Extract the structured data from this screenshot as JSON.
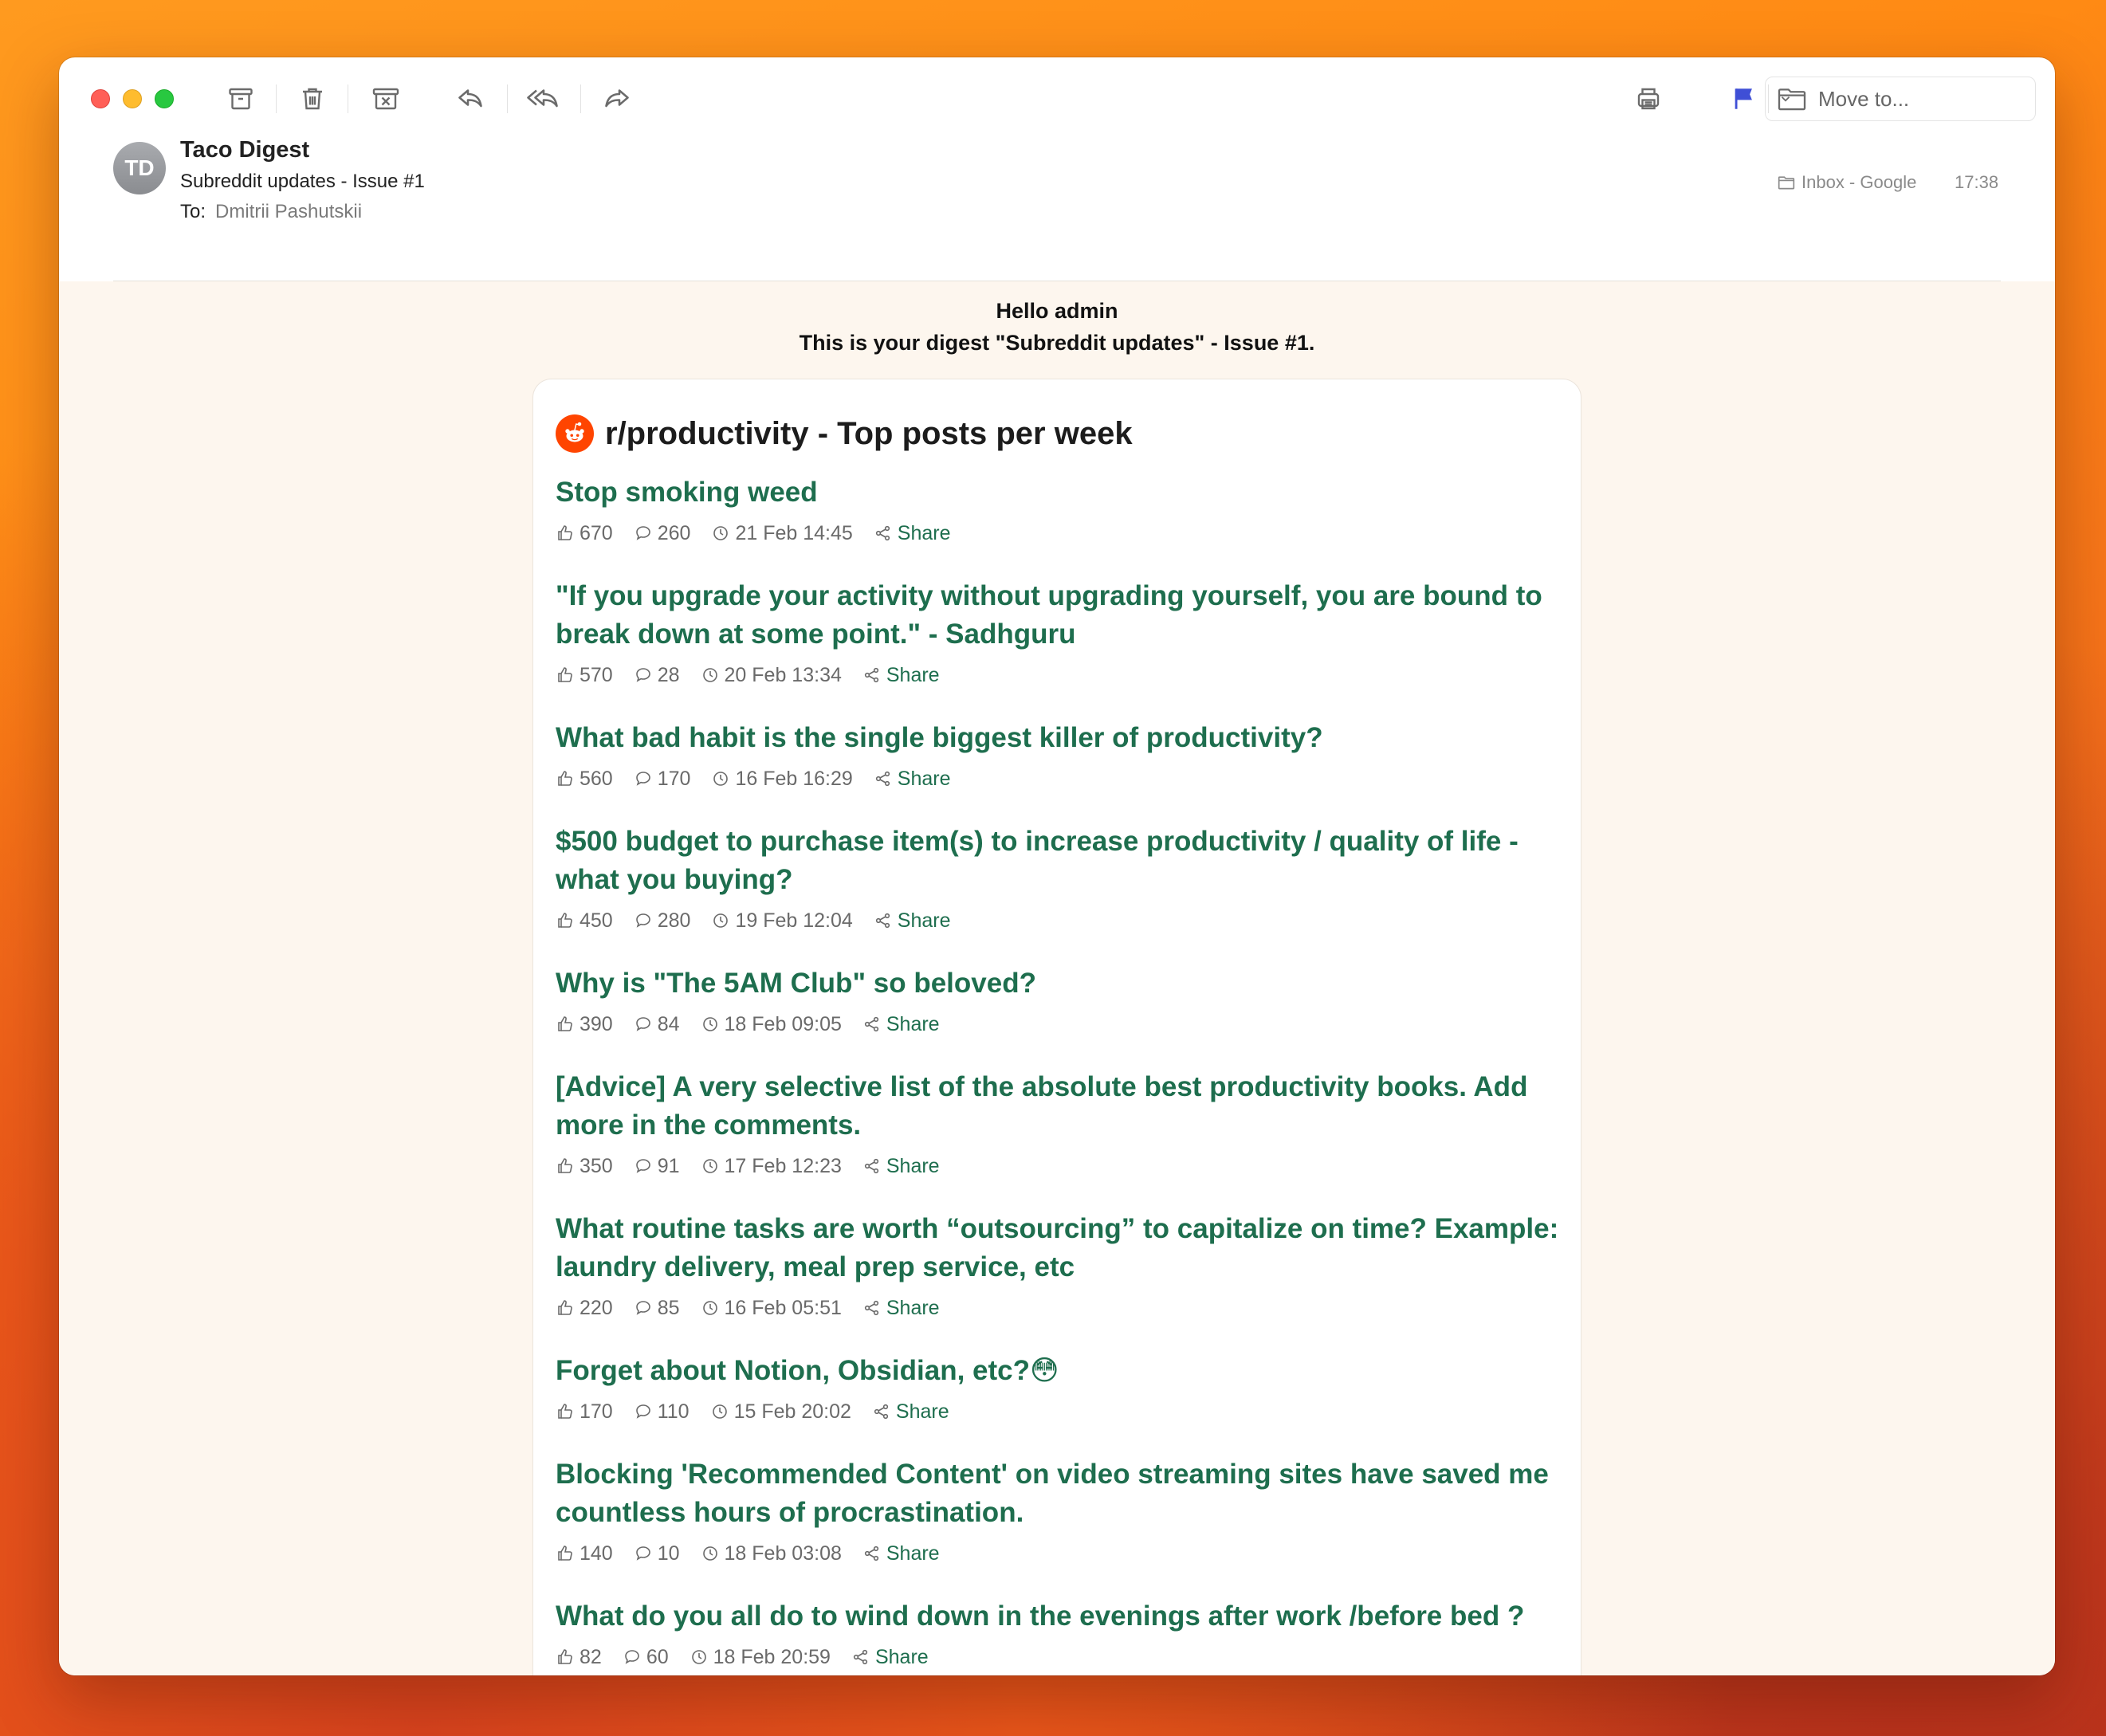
{
  "toolbar": {
    "move_to_label": "Move to..."
  },
  "header": {
    "avatar_initials": "TD",
    "sender": "Taco Digest",
    "subject": "Subreddit updates - Issue #1",
    "to_label": "To:",
    "to_name": "Dmitrii Pashutskii",
    "mailbox": "Inbox - Google",
    "time": "17:38"
  },
  "body": {
    "greeting": "Hello admin",
    "intro": "This is your digest \"Subreddit updates\" - Issue #1."
  },
  "card": {
    "title": "r/productivity - Top posts per week",
    "share_label": "Share",
    "posts": [
      {
        "title": "Stop smoking weed",
        "upvotes": "670",
        "comments": "260",
        "date": "21 Feb 14:45"
      },
      {
        "title": "\"If you upgrade your activity without upgrading yourself, you are bound to break down at some point.\" - Sadhguru",
        "upvotes": "570",
        "comments": "28",
        "date": "20 Feb 13:34"
      },
      {
        "title": "What bad habit is the single biggest killer of productivity?",
        "upvotes": "560",
        "comments": "170",
        "date": "16 Feb 16:29"
      },
      {
        "title": "$500 budget to purchase item(s) to increase productivity / quality of life - what you buying?",
        "upvotes": "450",
        "comments": "280",
        "date": "19 Feb 12:04"
      },
      {
        "title": "Why is \"The 5AM Club\" so beloved?",
        "upvotes": "390",
        "comments": "84",
        "date": "18 Feb 09:05"
      },
      {
        "title": "[Advice] A very selective list of the absolute best productivity books. Add more in the comments.",
        "upvotes": "350",
        "comments": "91",
        "date": "17 Feb 12:23"
      },
      {
        "title": "What routine tasks are worth “outsourcing” to capitalize on time? Example: laundry delivery, meal prep service, etc",
        "upvotes": "220",
        "comments": "85",
        "date": "16 Feb 05:51"
      },
      {
        "title": "Forget about Notion, Obsidian, etc?😳",
        "upvotes": "170",
        "comments": "110",
        "date": "15 Feb 20:02"
      },
      {
        "title": "Blocking 'Recommended Content' on video streaming sites have saved me countless hours of procrastination.",
        "upvotes": "140",
        "comments": "10",
        "date": "18 Feb 03:08"
      },
      {
        "title": "What do you all do to wind down in the evenings after work /before bed ?",
        "upvotes": "82",
        "comments": "60",
        "date": "18 Feb 20:59"
      }
    ]
  }
}
